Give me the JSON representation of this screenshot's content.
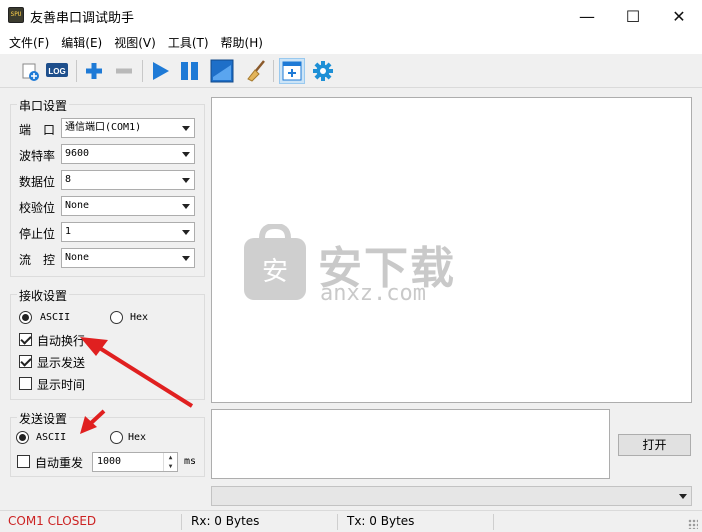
{
  "window": {
    "title": "友善串口调试助手",
    "app_icon_text": "SPU",
    "controls": {
      "minimize": "—",
      "maximize": "☐",
      "close": "✕"
    }
  },
  "menu": [
    "文件(F)",
    "编辑(E)",
    "视图(V)",
    "工具(T)",
    "帮助(H)"
  ],
  "toolbar": {
    "icons": [
      "new-session-icon",
      "log-icon",
      "add-icon",
      "remove-icon",
      "play-icon",
      "pause-icon",
      "window-icon",
      "clear-broom-icon",
      "add-panel-icon",
      "gear-icon"
    ],
    "log_label": "LOG"
  },
  "serial": {
    "title": "串口设置",
    "fields": [
      {
        "label": "端　口",
        "value": "通信端口(COM1)"
      },
      {
        "label": "波特率",
        "value": "9600"
      },
      {
        "label": "数据位",
        "value": "8"
      },
      {
        "label": "校验位",
        "value": "None"
      },
      {
        "label": "停止位",
        "value": "1"
      },
      {
        "label": "流　控",
        "value": "None"
      }
    ]
  },
  "receive": {
    "title": "接收设置",
    "ascii": "ASCII",
    "hex": "Hex",
    "mode_selected": "ASCII",
    "options": [
      {
        "label": "自动换行",
        "checked": true
      },
      {
        "label": "显示发送",
        "checked": true
      },
      {
        "label": "显示时间",
        "checked": false
      }
    ]
  },
  "send": {
    "title": "发送设置",
    "ascii": "ASCII",
    "hex": "Hex",
    "mode_selected": "ASCII",
    "repeat_label": "自动重发",
    "repeat_checked": false,
    "interval": "1000",
    "unit": "ms"
  },
  "open_button": "打开",
  "watermark": {
    "cn": "安下载",
    "domain": "anxz.com",
    "shield_char": "安"
  },
  "status": {
    "port": "COM1 CLOSED",
    "rx": "Rx: 0 Bytes",
    "tx": "Tx: 0 Bytes"
  },
  "colors": {
    "status_red": "#cc2222",
    "arrow_red": "#e02020",
    "toolbar_blue": "#1e7ad6"
  }
}
